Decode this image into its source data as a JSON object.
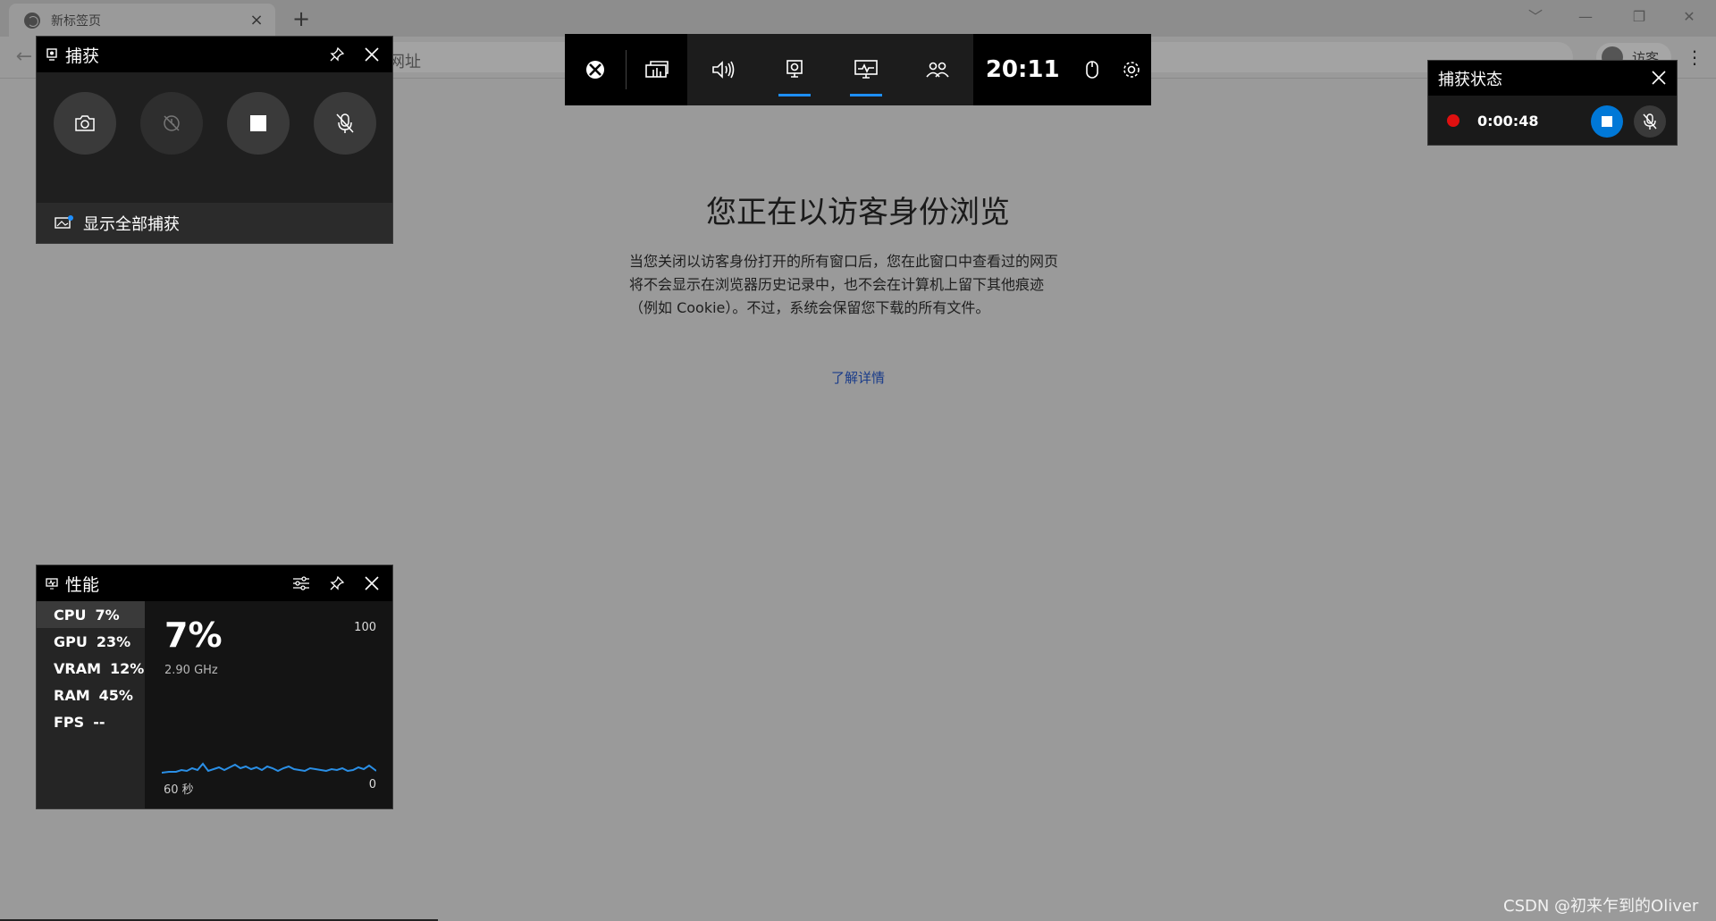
{
  "browser": {
    "tab_title": "新标签页",
    "tab_close": "×",
    "new_tab": "+",
    "omnibox_partial": "网址",
    "profile_label": "访客",
    "window_controls": [
      "﹀",
      "—",
      "❐",
      "✕"
    ]
  },
  "page": {
    "title": "您正在以访客身份浏览",
    "description_lines": [
      "当您关闭以访客身份打开的所有窗口后，您在此窗口中查看过的网页",
      "将不会显示在浏览器历史记录中，也不会在计算机上留下其他痕迹",
      "（例如 Cookie）。不过，系统会保留您下载的所有文件。"
    ],
    "learn_more": "了解详情"
  },
  "gamebar": {
    "clock": "20:11",
    "buttons": [
      "xbox-icon",
      "widget-menu-icon",
      "audio-icon",
      "capture-icon",
      "performance-icon",
      "social-icon",
      "mouse-icon",
      "settings-icon"
    ],
    "active": [
      "capture-icon",
      "performance-icon"
    ],
    "accent": "#1e8fff"
  },
  "capture_widget": {
    "title": "捕获",
    "footer_label": "显示全部捕获",
    "buttons": [
      "screenshot-icon",
      "record-last-icon",
      "stop-recording-icon",
      "mic-off-icon"
    ]
  },
  "status_widget": {
    "title": "捕获状态",
    "timer": "0:00:48",
    "rec_color": "#e01010",
    "stop_color": "#0078d7"
  },
  "perf_widget": {
    "title": "性能",
    "items": [
      {
        "label": "CPU",
        "value": "7%"
      },
      {
        "label": "GPU",
        "value": "23%"
      },
      {
        "label": "VRAM",
        "value": "12%"
      },
      {
        "label": "RAM",
        "value": "45%"
      },
      {
        "label": "FPS",
        "value": "--"
      }
    ],
    "big_value": "7%",
    "frequency": "2.90 GHz",
    "scale_max": "100",
    "scale_min": "0",
    "time_label": "60 秒",
    "graph_color": "#2a8fe6"
  },
  "watermark": "CSDN @初来乍到的Oliver"
}
